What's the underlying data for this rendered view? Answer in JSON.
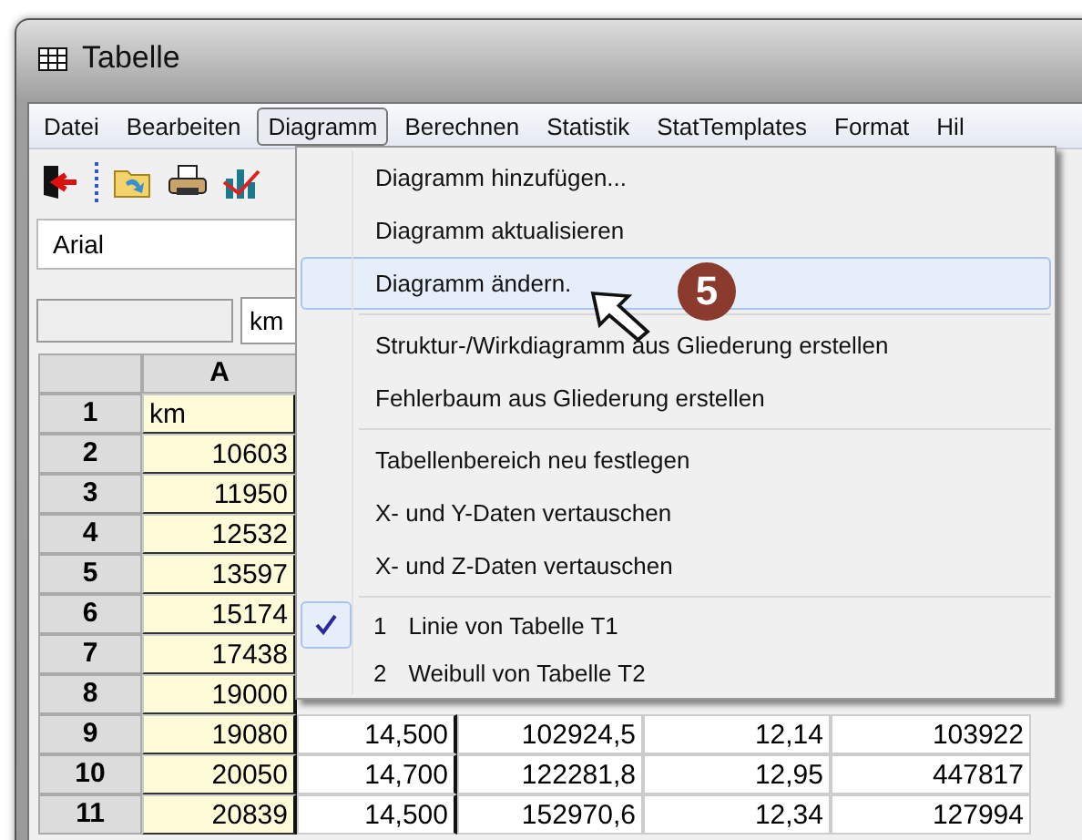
{
  "window": {
    "title": "Tabelle"
  },
  "menubar": [
    {
      "label": "Datei",
      "selected": false
    },
    {
      "label": "Bearbeiten",
      "selected": false
    },
    {
      "label": "Diagramm",
      "selected": true
    },
    {
      "label": "Berechnen",
      "selected": false
    },
    {
      "label": "Statistik",
      "selected": false
    },
    {
      "label": "StatTemplates",
      "selected": false
    },
    {
      "label": "Format",
      "selected": false
    },
    {
      "label": "Hil",
      "selected": false
    }
  ],
  "font_box": {
    "value": "Arial"
  },
  "formula_bar": {
    "value": "km"
  },
  "table": {
    "columns": [
      "A"
    ],
    "rows": [
      {
        "header": "1",
        "cells": [
          "km"
        ]
      },
      {
        "header": "2",
        "cells": [
          "10603"
        ]
      },
      {
        "header": "3",
        "cells": [
          "11950"
        ]
      },
      {
        "header": "4",
        "cells": [
          "12532"
        ]
      },
      {
        "header": "5",
        "cells": [
          "13597"
        ]
      },
      {
        "header": "6",
        "cells": [
          "15174"
        ]
      },
      {
        "header": "7",
        "cells": [
          "17438"
        ]
      },
      {
        "header": "8",
        "cells": [
          "19000"
        ]
      },
      {
        "header": "9",
        "cells": [
          "19080",
          "14,500",
          "102924,5",
          "12,14",
          "103922"
        ]
      },
      {
        "header": "10",
        "cells": [
          "20050",
          "14,700",
          "122281,8",
          "12,95",
          "447817"
        ]
      },
      {
        "header": "11",
        "cells": [
          "20839",
          "14,500",
          "152970,6",
          "12,34",
          "127994"
        ]
      }
    ]
  },
  "menu": {
    "items": [
      {
        "kind": "item",
        "label": "Diagramm hinzufügen...",
        "selected": false
      },
      {
        "kind": "item",
        "label": "Diagramm aktualisieren",
        "selected": false
      },
      {
        "kind": "item",
        "label": "Diagramm ändern.",
        "selected": true
      },
      {
        "kind": "separator"
      },
      {
        "kind": "item",
        "label": "Struktur-/Wirkdiagramm aus Gliederung erstellen",
        "selected": false
      },
      {
        "kind": "item",
        "label": "Fehlerbaum aus Gliederung erstellen",
        "selected": false
      },
      {
        "kind": "separator"
      },
      {
        "kind": "item",
        "label": "Tabellenbereich neu festlegen",
        "selected": false
      },
      {
        "kind": "item",
        "label": "X- und Y-Daten vertauschen",
        "selected": false
      },
      {
        "kind": "item",
        "label": "X- und Z-Daten vertauschen",
        "selected": false
      },
      {
        "kind": "separator"
      },
      {
        "kind": "check",
        "number": "1",
        "label": "Linie  von Tabelle T1",
        "checked": true
      },
      {
        "kind": "check",
        "number": "2",
        "label": "Weibull  von Tabelle T2",
        "checked": false
      }
    ]
  },
  "step_badge": "5"
}
